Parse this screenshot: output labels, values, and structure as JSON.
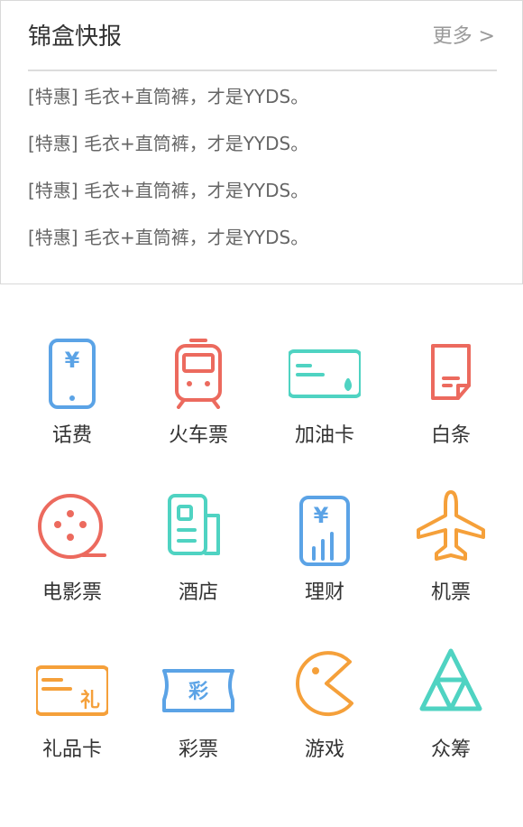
{
  "news": {
    "title": "锦盒快报",
    "more": "更多 >",
    "items": [
      "[特惠] 毛衣+直筒裤，才是YYDS。",
      "[特惠] 毛衣+直筒裤，才是YYDS。",
      "[特惠] 毛衣+直筒裤，才是YYDS。",
      "[特惠] 毛衣+直筒裤，才是YYDS。"
    ]
  },
  "services": [
    {
      "label": "话费",
      "icon": "phone-bill-icon",
      "color": "#5ba3e6"
    },
    {
      "label": "火车票",
      "icon": "train-icon",
      "color": "#ec6a5e"
    },
    {
      "label": "加油卡",
      "icon": "fuel-card-icon",
      "color": "#4fd3c2"
    },
    {
      "label": "白条",
      "icon": "iou-note-icon",
      "color": "#ec6a5e"
    },
    {
      "label": "电影票",
      "icon": "film-reel-icon",
      "color": "#ec6a5e"
    },
    {
      "label": "酒店",
      "icon": "hotel-icon",
      "color": "#4fd3c2"
    },
    {
      "label": "理财",
      "icon": "finance-icon",
      "color": "#5ba3e6"
    },
    {
      "label": "机票",
      "icon": "airplane-icon",
      "color": "#f5a03a"
    },
    {
      "label": "礼品卡",
      "icon": "gift-card-icon",
      "color": "#f5a03a"
    },
    {
      "label": "彩票",
      "icon": "lottery-ticket-icon",
      "color": "#5ba3e6"
    },
    {
      "label": "游戏",
      "icon": "pacman-game-icon",
      "color": "#f5a03a"
    },
    {
      "label": "众筹",
      "icon": "crowdfunding-triangle-icon",
      "color": "#4fd3c2"
    }
  ],
  "glyphs": {
    "yen": "¥",
    "gift": "礼",
    "lottery": "彩"
  }
}
